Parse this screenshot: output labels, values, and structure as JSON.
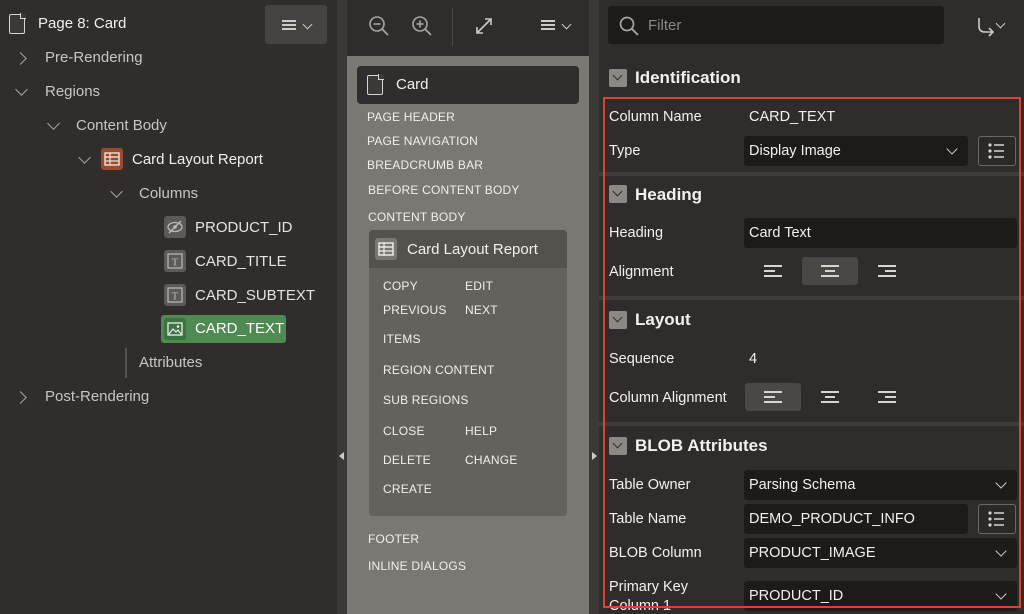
{
  "left_tree": {
    "page_title": "Page 8: Card",
    "items": {
      "pre_rendering": "Pre-Rendering",
      "regions": "Regions",
      "content_body": "Content Body",
      "card_layout_report": "Card Layout Report",
      "columns": "Columns",
      "product_id": "PRODUCT_ID",
      "card_title": "CARD_TITLE",
      "card_subtext": "CARD_SUBTEXT",
      "card_text": "CARD_TEXT",
      "attributes": "Attributes",
      "post_rendering": "Post-Rendering"
    }
  },
  "layout_panel": {
    "page_label": "Card",
    "positions_top": [
      "PAGE HEADER",
      "PAGE NAVIGATION",
      "BREADCRUMB BAR",
      "BEFORE CONTENT BODY",
      "CONTENT BODY"
    ],
    "region": {
      "title": "Card Layout Report",
      "copy": "COPY",
      "edit": "EDIT",
      "previous": "PREVIOUS",
      "next": "NEXT",
      "items": "ITEMS",
      "region_content": "REGION CONTENT",
      "sub_regions": "SUB REGIONS",
      "close": "CLOSE",
      "help": "HELP",
      "delete": "DELETE",
      "change": "CHANGE",
      "create": "CREATE"
    },
    "positions_bottom": [
      "FOOTER",
      "INLINE DIALOGS"
    ]
  },
  "property_editor": {
    "filter_placeholder": "Filter",
    "identification": {
      "title": "Identification",
      "column_name_label": "Column Name",
      "column_name_value": "CARD_TEXT",
      "type_label": "Type",
      "type_value": "Display Image"
    },
    "heading": {
      "title": "Heading",
      "heading_label": "Heading",
      "heading_value": "Card Text",
      "alignment_label": "Alignment",
      "alignment_selected": "center"
    },
    "layout": {
      "title": "Layout",
      "sequence_label": "Sequence",
      "sequence_value": "4",
      "column_alignment_label": "Column Alignment",
      "column_alignment_selected": "left"
    },
    "blob": {
      "title": "BLOB Attributes",
      "table_owner_label": "Table Owner",
      "table_owner_value": "Parsing Schema",
      "table_name_label": "Table Name",
      "table_name_value": "DEMO_PRODUCT_INFO",
      "blob_column_label": "BLOB Column",
      "blob_column_value": "PRODUCT_IMAGE",
      "pk_label_line1": "Primary Key",
      "pk_label_line2": "Column 1",
      "pk_value": "PRODUCT_ID"
    }
  },
  "colors": {
    "highlight_box": "#d9432f",
    "selected_node": "#4e8a52",
    "report_icon": "#9a4a2e"
  }
}
